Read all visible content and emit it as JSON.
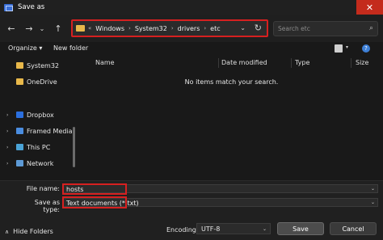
{
  "window": {
    "title": "Save as",
    "close_glyph": "✕"
  },
  "nav": {
    "back_glyph": "←",
    "forward_glyph": "→",
    "history_glyph": "⌄",
    "up_glyph": "↑",
    "path_prefix": "«",
    "path_separator": "›",
    "path": [
      "Windows",
      "System32",
      "drivers",
      "etc"
    ],
    "dropdown_glyph": "⌄",
    "refresh_glyph": "↻",
    "search_placeholder": "Search etc",
    "search_glyph": "⌕"
  },
  "toolbar": {
    "organize": "Organize ▾",
    "new_folder": "New folder",
    "view_arrow": "▾",
    "help": "?"
  },
  "sidebar": {
    "items": [
      {
        "label": "System32",
        "icon": "folder-icon",
        "expandable": false
      },
      {
        "label": "OneDrive",
        "icon": "folder-icon",
        "expandable": false
      },
      {
        "label": "Dropbox",
        "icon": "dropbox-icon",
        "expandable": true
      },
      {
        "label": "Framed Media",
        "icon": "media-icon",
        "expandable": true
      },
      {
        "label": "This PC",
        "icon": "pc-icon",
        "expandable": true
      },
      {
        "label": "Network",
        "icon": "network-icon",
        "expandable": true
      }
    ],
    "chevron": "›"
  },
  "columns": {
    "name": "Name",
    "date": "Date modified",
    "type": "Type",
    "size": "Size"
  },
  "empty_message": "No items match your search.",
  "form": {
    "file_name_label": "File name:",
    "file_name_value": "hosts",
    "save_type_label": "Save as type:",
    "save_type_value": "Text documents (*.txt)",
    "arrow": "⌄"
  },
  "footer": {
    "hide_folders": "Hide Folders",
    "hide_chevron": "∧",
    "encoding_label": "Encoding:",
    "encoding_value": "UTF-8",
    "encoding_arrow": "⌄",
    "save": "Save",
    "cancel": "Cancel"
  },
  "colors": {
    "highlight": "#d62020",
    "close_button": "#c42b1c",
    "folder": "#e8b84a"
  }
}
